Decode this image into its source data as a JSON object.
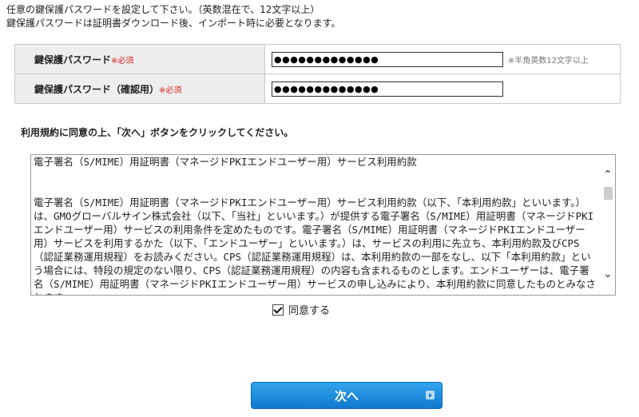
{
  "intro": {
    "line1": "任意の鍵保護パスワードを設定して下さい。（英数混在で、12文字以上）",
    "line2": "鍵保護パスワードは証明書ダウンロード後、インポート時に必要となります。"
  },
  "password_form": {
    "password_label": "鍵保護パスワード",
    "password_required": "※必須",
    "password_value": "●●●●●●●●●●●●●",
    "password_hint": "※半角英数12文字以上",
    "confirm_label": "鍵保護パスワード（確認用）",
    "confirm_required": "※必須",
    "confirm_value": "●●●●●●●●●●●●●"
  },
  "agreement": {
    "instruction": "利用規約に同意の上、「次へ」ボタンをクリックしてください。",
    "terms_title": "電子署名（S/MIME）用証明書（マネージドPKIエンドユーザー用）サービス利用約款",
    "terms_body": "電子署名（S/MIME）用証明書（マネージドPKIエンドユーザー用）サービス利用約款（以下、「本利用約款」といいます。）は、GMOグローバルサイン株式会社（以下、「当社」といいます。）が提供する電子署名（S/MIME）用証明書（マネージドPKIエンドユーザー用）サービスの利用条件を定めたものです。電子署名（S/MIME）用証明書（マネージドPKIエンドユーザー用）サービスを利用するかた（以下、「エンドユーザー」といいます。）は、サービスの利用に先立ち、本利用約款及びCPS（認証業務運用規程）をお読みください。CPS（認証業務運用規程）は、本利用約款の一部をなし、以下「本利用約款」という場合には、特段の規定のない限り、CPS（認証業務運用規程）の内容も含まれるものとします。エンドユーザーは、電子署名（S/MIME）用証明書（マネージドPKIエンドユーザー用）サービスの申し込みにより、本利用約款に同意したものとみなされます。",
    "agree_label": "同意する",
    "agree_checked": true
  },
  "actions": {
    "next_label": "次へ"
  }
}
